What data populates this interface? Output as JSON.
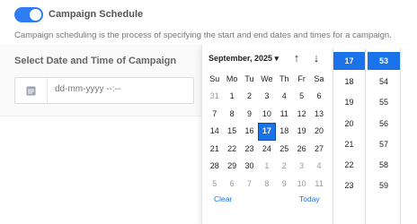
{
  "header": {
    "title": "Campaign Schedule",
    "description": "Campaign scheduling is the process of specifying the start and end dates and times for a campaign."
  },
  "form": {
    "section_label": "Select Date and Time of Campaign",
    "date_placeholder": "dd-mm-yyyy --:--"
  },
  "picker": {
    "month_label": "September, 2025 ▾",
    "nav_up": "↑",
    "nav_down": "↓",
    "weekdays": [
      "Su",
      "Mo",
      "Tu",
      "We",
      "Th",
      "Fr",
      "Sa"
    ],
    "days": [
      {
        "label": "31",
        "muted": true
      },
      {
        "label": "1"
      },
      {
        "label": "2"
      },
      {
        "label": "3"
      },
      {
        "label": "4"
      },
      {
        "label": "5"
      },
      {
        "label": "6"
      },
      {
        "label": "7"
      },
      {
        "label": "8"
      },
      {
        "label": "9"
      },
      {
        "label": "10"
      },
      {
        "label": "11"
      },
      {
        "label": "12"
      },
      {
        "label": "13"
      },
      {
        "label": "14"
      },
      {
        "label": "15"
      },
      {
        "label": "16"
      },
      {
        "label": "17",
        "selected": true
      },
      {
        "label": "18"
      },
      {
        "label": "19"
      },
      {
        "label": "20"
      },
      {
        "label": "21"
      },
      {
        "label": "22"
      },
      {
        "label": "23"
      },
      {
        "label": "24"
      },
      {
        "label": "25"
      },
      {
        "label": "26"
      },
      {
        "label": "27"
      },
      {
        "label": "28"
      },
      {
        "label": "29"
      },
      {
        "label": "30"
      },
      {
        "label": "1",
        "muted": true
      },
      {
        "label": "2",
        "muted": true
      },
      {
        "label": "3",
        "muted": true
      },
      {
        "label": "4",
        "muted": true
      },
      {
        "label": "5",
        "muted": true
      },
      {
        "label": "6",
        "muted": true
      },
      {
        "label": "7",
        "muted": true
      },
      {
        "label": "8",
        "muted": true
      },
      {
        "label": "9",
        "muted": true
      },
      {
        "label": "10",
        "muted": true
      },
      {
        "label": "11",
        "muted": true
      }
    ],
    "clear_label": "Clear",
    "today_label": "Today"
  },
  "time": {
    "hours": [
      {
        "label": "17",
        "selected": true
      },
      {
        "label": "18"
      },
      {
        "label": "19"
      },
      {
        "label": "20"
      },
      {
        "label": "21"
      },
      {
        "label": "22"
      },
      {
        "label": "23"
      }
    ],
    "minutes": [
      {
        "label": "53",
        "selected": true
      },
      {
        "label": "54"
      },
      {
        "label": "55"
      },
      {
        "label": "56"
      },
      {
        "label": "57"
      },
      {
        "label": "58"
      },
      {
        "label": "59"
      }
    ]
  },
  "colors": {
    "accent": "#1a73e8",
    "toggle_on": "#2e7cf6"
  }
}
